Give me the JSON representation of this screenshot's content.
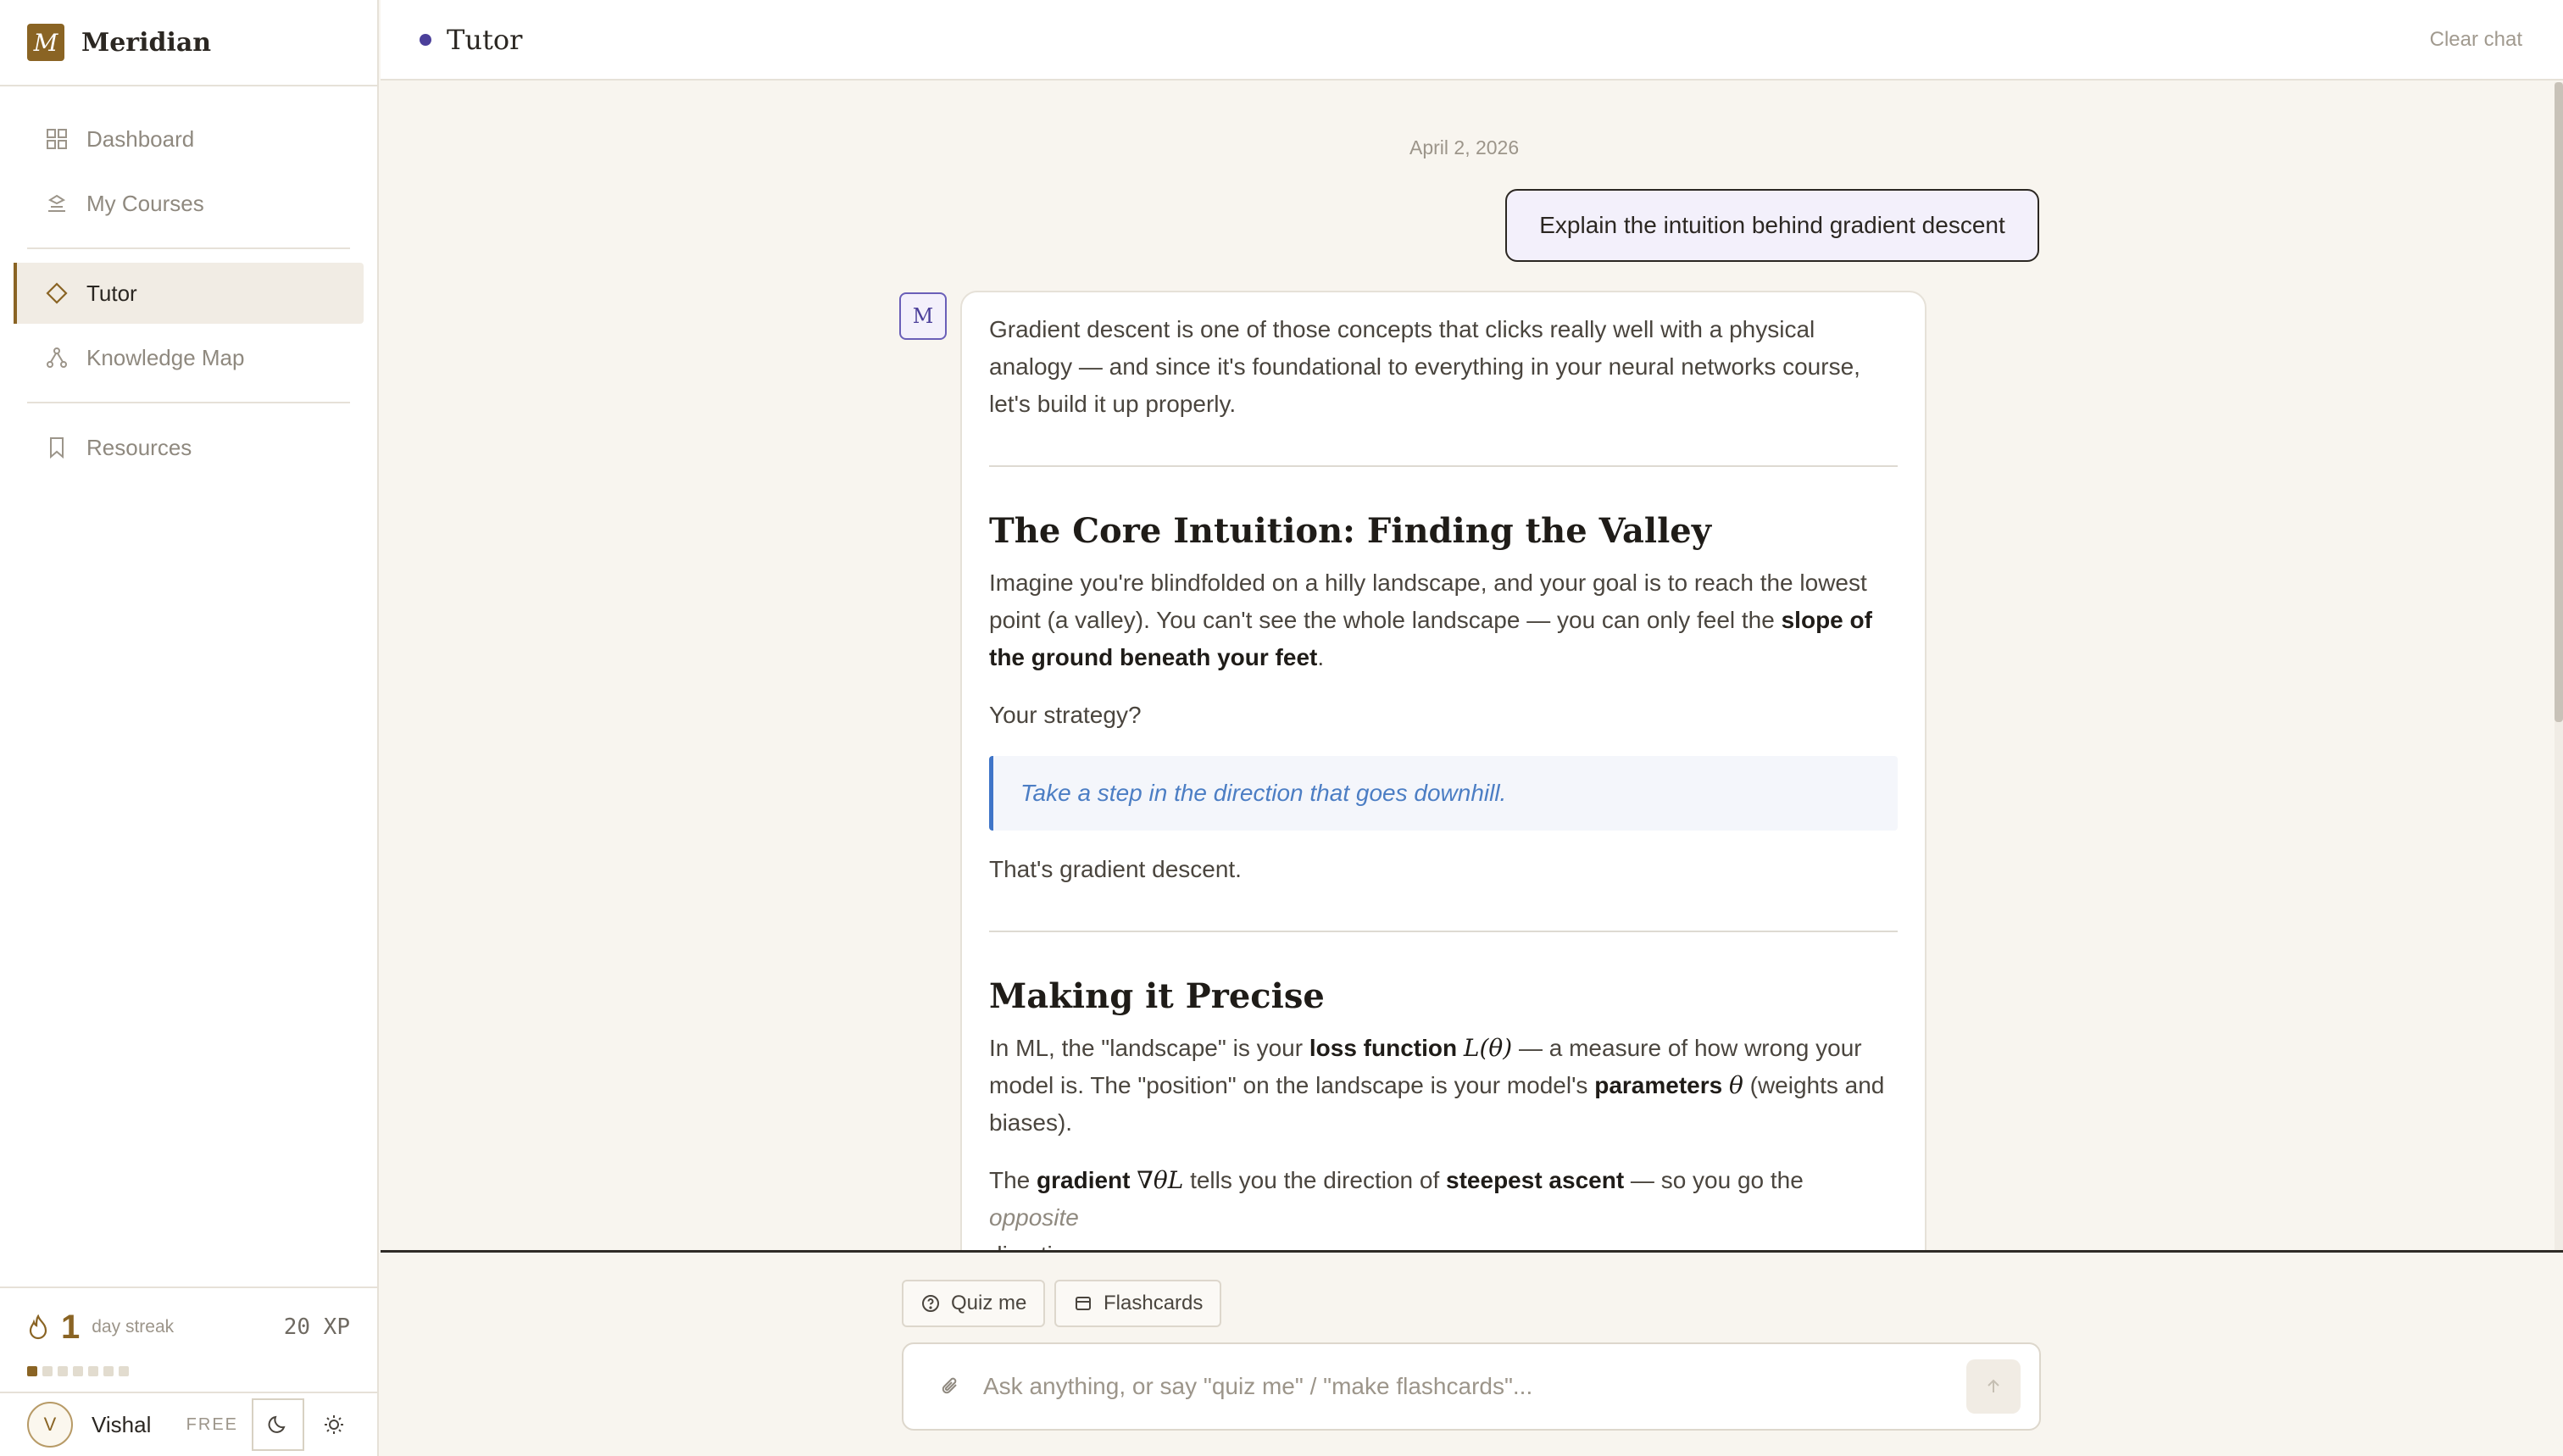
{
  "app": {
    "logo_letter": "M",
    "name": "Meridian"
  },
  "sidebar": {
    "items": [
      {
        "label": "Dashboard",
        "icon": "grid-icon"
      },
      {
        "label": "My Courses",
        "icon": "courses-icon"
      },
      {
        "label": "Tutor",
        "icon": "diamond-icon",
        "active": true
      },
      {
        "label": "Knowledge Map",
        "icon": "graph-icon"
      },
      {
        "label": "Resources",
        "icon": "bookmark-icon"
      }
    ],
    "streak": {
      "count": "1",
      "label": "day streak",
      "xp": "20 XP",
      "days_filled": 1,
      "days_total": 7
    },
    "user": {
      "initial": "V",
      "name": "Vishal",
      "plan": "FREE"
    }
  },
  "header": {
    "title": "Tutor",
    "clear_label": "Clear chat"
  },
  "chat": {
    "date": "April 2, 2026",
    "user_message": "Explain the intuition behind gradient descent",
    "bot_avatar": "M",
    "intro": "Gradient descent is one of those concepts that clicks really well with a physical analogy — and since it's foundational to everything in your neural networks course, let's build it up properly.",
    "section1": {
      "heading": "The Core Intuition: Finding the Valley",
      "p1_a": "Imagine you're blindfolded on a hilly landscape, and your goal is to reach the lowest point (a valley). You can't see the whole landscape — you can only feel the ",
      "p1_b": "slope of the ground beneath your feet",
      "p1_c": ".",
      "p2": "Your strategy?",
      "quote": "Take a step in the direction that goes downhill.",
      "p3": "That's gradient descent."
    },
    "section2": {
      "heading": "Making it Precise",
      "p1_a": "In ML, the \"landscape\" is your ",
      "p1_b": "loss function",
      "p1_math": "L(θ)",
      "p1_c": " — a measure of how wrong your model is. The \"position\" on the landscape is your model's ",
      "p1_d": "parameters",
      "p1_math2": "θ",
      "p1_e": " (weights and biases).",
      "p2_a": "The ",
      "p2_b": "gradient",
      "p2_math": "∇θL",
      "p2_c": " tells you the direction of ",
      "p2_d": "steepest ascent",
      "p2_e": " — so you go the ",
      "p2_f": "opposite",
      "p2_g": "direction:"
    }
  },
  "composer": {
    "chips": [
      {
        "label": "Quiz me",
        "icon": "question-icon"
      },
      {
        "label": "Flashcards",
        "icon": "cards-icon"
      }
    ],
    "placeholder": "Ask anything, or say \"quiz me\" / \"make flashcards\"..."
  },
  "colors": {
    "accent": "#8a6424",
    "tutor": "#4b3f9a",
    "quote": "#3f75c8"
  }
}
